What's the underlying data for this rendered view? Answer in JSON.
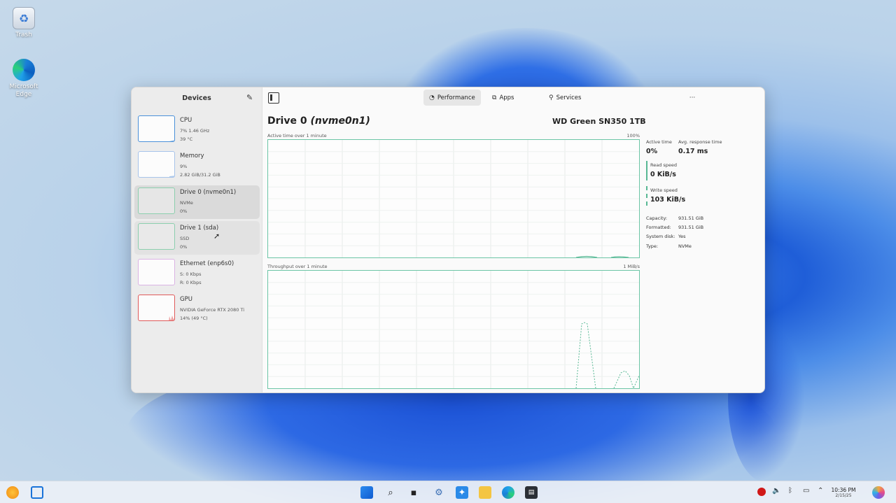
{
  "desktop": {
    "icons": [
      {
        "label": "Trash"
      },
      {
        "label": "Microsoft Edge"
      }
    ]
  },
  "sidebar": {
    "title": "Devices",
    "devices": [
      {
        "name": "CPU",
        "line1": "7% 1.46 GHz",
        "line2": "39 °C",
        "color": "#4a90d9"
      },
      {
        "name": "Memory",
        "line1": "9%",
        "line2": "2.82 GiB/31.2 GiB",
        "color": "#7aa8e0"
      },
      {
        "name": "Drive 0 (nvme0n1)",
        "line1": "NVMe",
        "line2": "0%",
        "color": "#5fb890"
      },
      {
        "name": "Drive 1 (sda)",
        "line1": "SSD",
        "line2": "0%",
        "color": "#5fb890"
      },
      {
        "name": "Ethernet (enp6s0)",
        "line1": "S: 0 Kbps",
        "line2": "R: 0 Kbps",
        "color": "#c78bd6"
      },
      {
        "name": "GPU",
        "line1": "NVIDIA GeForce RTX 2080 Ti",
        "line2": "14% (49 °C)",
        "color": "#e05a5a"
      }
    ]
  },
  "toolbar": {
    "tabs": [
      {
        "label": "Performance",
        "icon": "gauge-icon",
        "active": true
      },
      {
        "label": "Apps",
        "icon": "apps-icon",
        "active": false
      },
      {
        "label": "Services",
        "icon": "services-icon",
        "active": false
      }
    ],
    "menu_glyph": "···",
    "minimize_glyph": "–",
    "maximize_glyph": "▢",
    "close_glyph": "✕"
  },
  "main": {
    "title_prefix": "Drive 0 ",
    "title_paren": "(nvme0n1)",
    "model": "WD Green SN350 1TB",
    "graph1": {
      "caption": "Active time over 1 minute",
      "max": "100%"
    },
    "graph2": {
      "caption": "Throughput over 1 minute",
      "max": "1 MiB/s"
    },
    "stats": {
      "active_time_label": "Active time",
      "active_time_value": "0%",
      "avg_response_label": "Avg. response time",
      "avg_response_value": "0.17 ms",
      "read_speed_label": "Read speed",
      "read_speed_value": "0 KiB/s",
      "write_speed_label": "Write speed",
      "write_speed_value": "103 KiB/s"
    },
    "properties": [
      {
        "key": "Capacity:",
        "value": "931.51 GiB"
      },
      {
        "key": "Formatted:",
        "value": "931.51 GiB"
      },
      {
        "key": "System disk:",
        "value": "Yes"
      },
      {
        "key": "Type:",
        "value": "NVMe"
      }
    ]
  },
  "taskbar": {
    "clock_time": "10:36 PM",
    "clock_date": "2/15/25"
  },
  "colors": {
    "accent_green": "#58b894",
    "graph_border": "#6cc5a6"
  }
}
